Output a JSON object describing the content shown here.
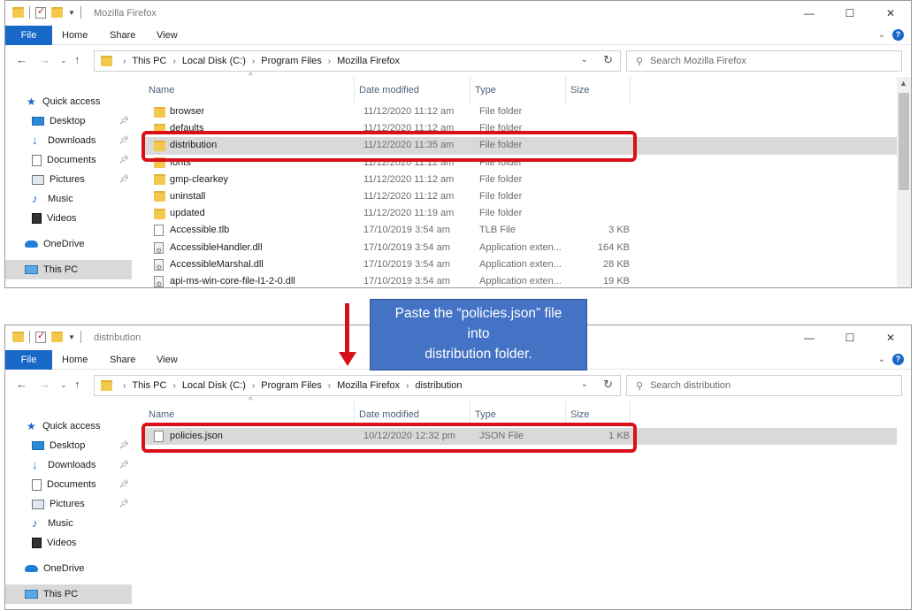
{
  "window1": {
    "title": "Mozilla Firefox",
    "ribbon_tabs": [
      "File",
      "Home",
      "Share",
      "View"
    ],
    "breadcrumb": [
      "This PC",
      "Local Disk (C:)",
      "Program Files",
      "Mozilla Firefox"
    ],
    "search_placeholder": "Search Mozilla Firefox",
    "columns": [
      "Name",
      "Date modified",
      "Type",
      "Size"
    ],
    "files": [
      {
        "name": "browser",
        "date": "11/12/2020 11:12 am",
        "type": "File folder",
        "size": "",
        "icon": "folder-icon"
      },
      {
        "name": "defaults",
        "date": "11/12/2020 11:12 am",
        "type": "File folder",
        "size": "",
        "icon": "folder-icon"
      },
      {
        "name": "distribution",
        "date": "11/12/2020 11:35 am",
        "type": "File folder",
        "size": "",
        "icon": "folder-icon",
        "selected": true
      },
      {
        "name": "fonts",
        "date": "11/12/2020 11:12 am",
        "type": "File folder",
        "size": "",
        "icon": "folder-icon"
      },
      {
        "name": "gmp-clearkey",
        "date": "11/12/2020 11:12 am",
        "type": "File folder",
        "size": "",
        "icon": "folder-icon"
      },
      {
        "name": "uninstall",
        "date": "11/12/2020 11:12 am",
        "type": "File folder",
        "size": "",
        "icon": "folder-icon"
      },
      {
        "name": "updated",
        "date": "11/12/2020 11:19 am",
        "type": "File folder",
        "size": "",
        "icon": "folder-icon"
      },
      {
        "name": "Accessible.tlb",
        "date": "17/10/2019 3:54 am",
        "type": "TLB File",
        "size": "3 KB",
        "icon": "file-icon"
      },
      {
        "name": "AccessibleHandler.dll",
        "date": "17/10/2019 3:54 am",
        "type": "Application exten...",
        "size": "164 KB",
        "icon": "dll-icon"
      },
      {
        "name": "AccessibleMarshal.dll",
        "date": "17/10/2019 3:54 am",
        "type": "Application exten...",
        "size": "28 KB",
        "icon": "dll-icon"
      },
      {
        "name": "api-ms-win-core-file-l1-2-0.dll",
        "date": "17/10/2019 3:54 am",
        "type": "Application exten...",
        "size": "19 KB",
        "icon": "dll-icon"
      }
    ]
  },
  "window2": {
    "title": "distribution",
    "ribbon_tabs": [
      "File",
      "Home",
      "Share",
      "View"
    ],
    "breadcrumb": [
      "This PC",
      "Local Disk (C:)",
      "Program Files",
      "Mozilla Firefox",
      "distribution"
    ],
    "search_placeholder": "Search distribution",
    "columns": [
      "Name",
      "Date modified",
      "Type",
      "Size"
    ],
    "files": [
      {
        "name": "policies.json",
        "date": "10/12/2020 12:32 pm",
        "type": "JSON File",
        "size": "1 KB",
        "icon": "file-icon",
        "selected": true
      }
    ]
  },
  "sidebar": {
    "items": [
      {
        "label": "Quick access",
        "icon": "star-icon",
        "pinned": false
      },
      {
        "label": "Desktop",
        "icon": "desktop-icon",
        "pinned": true
      },
      {
        "label": "Downloads",
        "icon": "download-icon",
        "pinned": true
      },
      {
        "label": "Documents",
        "icon": "documents-icon",
        "pinned": true
      },
      {
        "label": "Pictures",
        "icon": "pictures-icon",
        "pinned": true
      },
      {
        "label": "Music",
        "icon": "music-icon",
        "pinned": false
      },
      {
        "label": "Videos",
        "icon": "videos-icon",
        "pinned": false
      },
      {
        "label": "OneDrive",
        "icon": "onedrive-icon",
        "pinned": false
      },
      {
        "label": "This PC",
        "icon": "this-pc-icon",
        "pinned": false,
        "selected": true
      }
    ]
  },
  "callout": {
    "text": "Paste the “policies.json” file\ninto\ndistribution folder."
  },
  "colors": {
    "accent": "#1868c8",
    "highlight_box": "#d90f1a",
    "callout_bg": "#4472c4"
  }
}
